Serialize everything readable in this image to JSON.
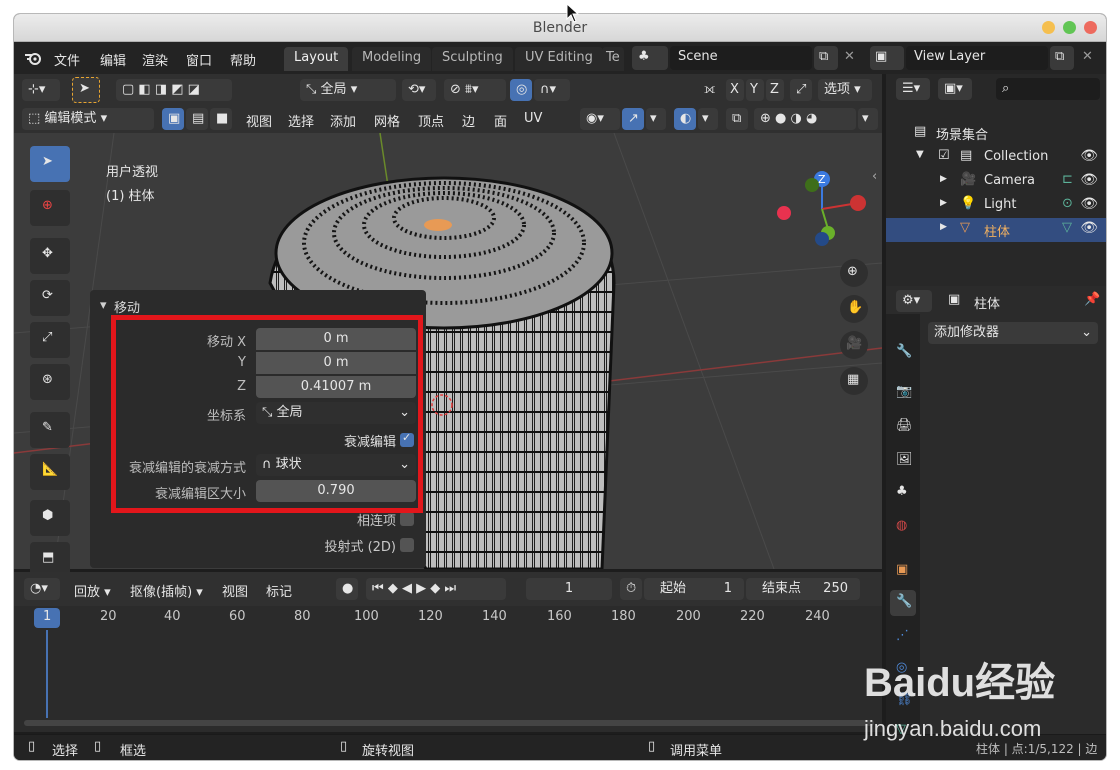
{
  "window": {
    "title": "Blender"
  },
  "menubar": {
    "items": [
      "文件",
      "编辑",
      "渲染",
      "窗口",
      "帮助"
    ],
    "workspaces": [
      "Layout",
      "Modeling",
      "Sculpting",
      "UV Editing",
      "Te"
    ],
    "scene": "Scene",
    "view_layer": "View Layer"
  },
  "header": {
    "transform_orientation": "全局",
    "options_label": "选项",
    "axes": [
      "X",
      "Y",
      "Z"
    ],
    "mode": "编辑模式",
    "menus": [
      "视图",
      "选择",
      "添加",
      "网格",
      "顶点",
      "边",
      "面",
      "UV"
    ]
  },
  "viewport": {
    "view_name": "用户透视",
    "object_name": "(1) 柱体",
    "gizmo_labels": {
      "z": "Z"
    }
  },
  "operator_panel": {
    "title": "移动",
    "move_x_label": "移动 X",
    "move_x_value": "0 m",
    "y_label": "Y",
    "y_value": "0 m",
    "z_label": "Z",
    "z_value": "0.41007 m",
    "orientation_label": "坐标系",
    "orientation_value": "全局",
    "proportional_label": "衰减编辑",
    "proportional_checked": true,
    "falloff_label": "衰减编辑的衰减方式",
    "falloff_value": "球状",
    "size_label": "衰减编辑区大小",
    "size_value": "0.790",
    "connected_label": "相连项",
    "connected_checked": false,
    "projected_label": "投射式 (2D)",
    "projected_checked": false
  },
  "outliner": {
    "root": "场景集合",
    "items": [
      {
        "name": "Collection",
        "icon": "collection-icon"
      },
      {
        "name": "Camera",
        "icon": "camera-icon"
      },
      {
        "name": "Light",
        "icon": "light-icon"
      },
      {
        "name": "柱体",
        "icon": "mesh-icon",
        "selected": true
      }
    ]
  },
  "properties": {
    "object_name": "柱体",
    "add_modifier": "添加修改器"
  },
  "timeline": {
    "menus": [
      "回放",
      "抠像(插帧)",
      "视图",
      "标记"
    ],
    "current_frame": "1",
    "start_label": "起始",
    "start_value": "1",
    "end_label": "结束点",
    "end_value": "250",
    "ruler": [
      "1",
      "20",
      "40",
      "60",
      "80",
      "100",
      "120",
      "140",
      "160",
      "180",
      "200",
      "220",
      "240"
    ]
  },
  "statusbar": {
    "select": "选择",
    "box_select": "框选",
    "rotate_view": "旋转视图",
    "call_menu": "调用菜单",
    "stats": "柱体 | 点:1/5,122 | 边"
  },
  "watermark": {
    "text": "Baidu经验",
    "url": "jingyan.baidu.com"
  },
  "colors": {
    "accent": "#4772b3",
    "highlight": "#e2161b",
    "selected_row": "#334d80"
  }
}
